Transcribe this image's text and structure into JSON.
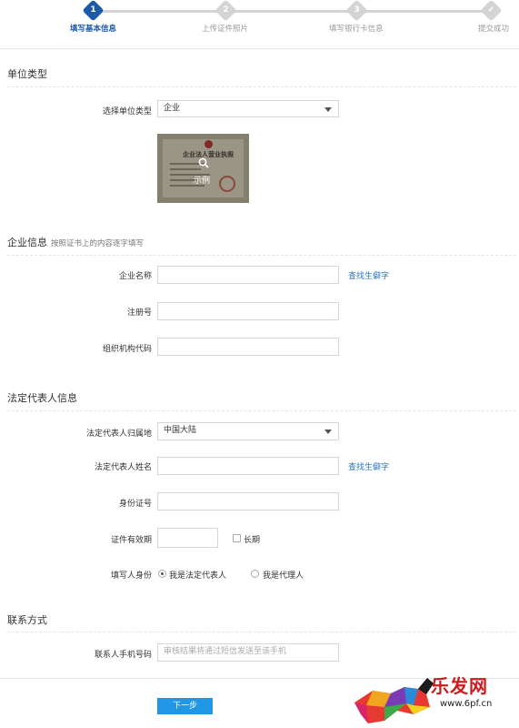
{
  "stepper": {
    "steps": [
      {
        "num": "1",
        "label": "填写基本信息",
        "active": true
      },
      {
        "num": "2",
        "label": "上传证件照片",
        "active": false
      },
      {
        "num": "3",
        "label": "填写银行卡信息",
        "active": false
      },
      {
        "num": "✔",
        "label": "提交成功",
        "active": false
      }
    ]
  },
  "unit_type": {
    "title": "单位类型",
    "select_label": "选择单位类型",
    "select_value": "企业",
    "example_label": "示例",
    "license_title": "企业法人营业执照"
  },
  "enterprise": {
    "title": "企业信息",
    "subtitle": "按照证书上的内容逐字填写",
    "name_label": "企业名称",
    "name_value": "",
    "rare_char_link": "查找生僻字",
    "reg_no_label": "注册号",
    "reg_no_value": "",
    "org_code_label": "组织机构代码",
    "org_code_value": ""
  },
  "legal_rep": {
    "title": "法定代表人信息",
    "region_label": "法定代表人归属地",
    "region_value": "中国大陆",
    "name_label": "法定代表人姓名",
    "name_value": "",
    "rare_char_link": "查找生僻字",
    "id_label": "身份证号",
    "id_value": "",
    "validity_label": "证件有效期",
    "validity_value": "",
    "long_term_label": "长期",
    "long_term_checked": false,
    "filler_label": "填写人身份",
    "filler_options": [
      "我是法定代表人",
      "我是代理人"
    ],
    "filler_selected": 0
  },
  "contact": {
    "title": "联系方式",
    "phone_label": "联系人手机号码",
    "phone_placeholder": "审核结果将通过短信发送至该手机"
  },
  "actions": {
    "next_label": "下一步"
  },
  "watermark": {
    "brand_text": "乐发网",
    "url_text": "www.6pf.cn"
  },
  "colors": {
    "primary": "#1c5aa8",
    "button": "#2196e4",
    "link": "#2b74c7",
    "watermark_red": "#c81e1e"
  }
}
